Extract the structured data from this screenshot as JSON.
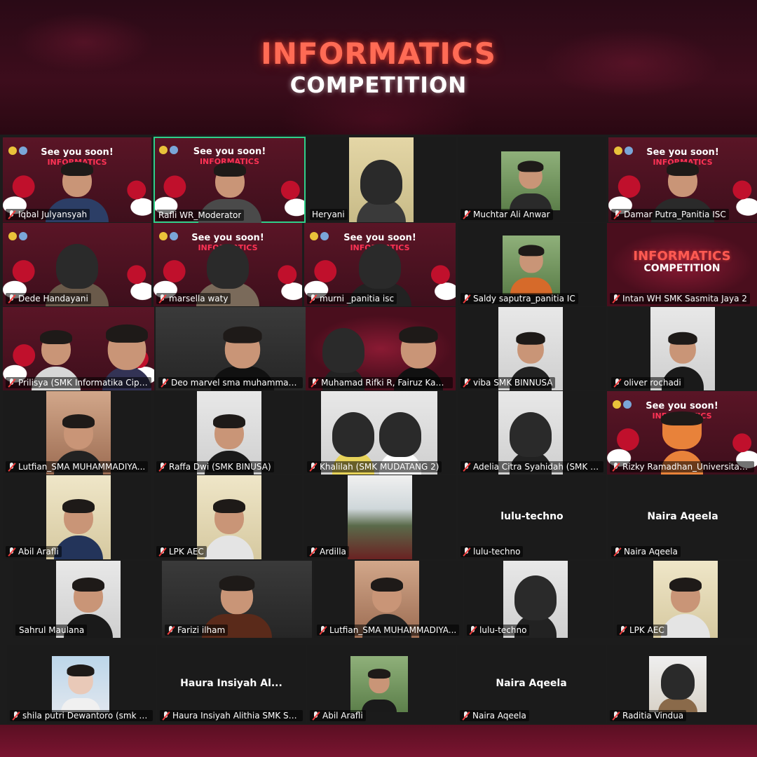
{
  "header": {
    "title_line1": "INFORMATICS",
    "title_line2": "COMPETITION"
  },
  "banner": {
    "headline": "See you soon!",
    "subline": "INFORMATICS"
  },
  "promo": {
    "line1": "INFORMATICS",
    "line2": "COMPETITION"
  },
  "colors": {
    "header_red": "#ff6b55",
    "active_speaker_border": "#2fd08a",
    "muted_mic": "#ef3b3b",
    "grid_bg": "#1c1c1c"
  },
  "participants": {
    "p01": "Iqbal Julyansyah",
    "p02": "Rafli WR_Moderator",
    "p03": "Heryani",
    "p04": "Muchtar Ali Anwar",
    "p05": "Damar Putra_Panitia ISC",
    "p06": "Dede Handayani",
    "p07": "marsella waty",
    "p08": "murni _panitia isc",
    "p09": "Saldy saputra_panitia IC",
    "p10": "Intan WH SMK Sasmita Jaya 2",
    "p11": "Prilisya (SMK Informatika Cipu...",
    "p12": "Deo marvel sma muhammadi...",
    "p13": "Muhamad Rifki R, Fairuz Kami...",
    "p14": "viba SMK BINNUSA",
    "p15": "oliver rochadi",
    "p16": "Lutfian_SMA MUHAMMADIYA...",
    "p17": "Raffa Dwi (SMK BINUSA)",
    "p18": "Khalilah (SMK MUDATANG 2)",
    "p19": "Adelia Citra Syahidah (SMK S...",
    "p20": "Rizky Ramadhan_Universitas P...",
    "p21": "Abil Arafli",
    "p22": "LPK AEC",
    "p23": "Ardilla",
    "p24": "lulu-techno",
    "p25": "Naira Aqeela",
    "p26": "Sahrul Maulana",
    "p27": "Farizi ilham",
    "p28": "Lutfian_SMA MUHAMMADIYA...",
    "p29": "lulu-techno",
    "p30": "LPK AEC",
    "p31": "shila putri Dewantoro (smk te...",
    "p32": "Haura Insiyah Alithia SMK Sas...",
    "p33": "Abil Arafli",
    "p34": "Naira Aqeela",
    "p35": "Raditia Vindua"
  },
  "center_names": {
    "p24": "lulu-techno",
    "p25": "Naira Aqeela",
    "p32": "Haura  Insiyah  Al...",
    "p34": "Naira Aqeela"
  }
}
